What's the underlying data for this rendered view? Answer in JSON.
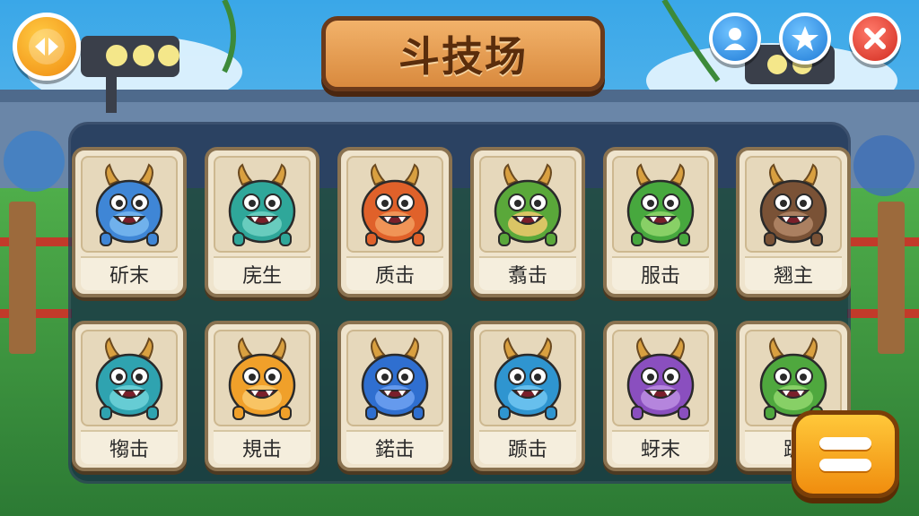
{
  "header": {
    "title": "斗技场"
  },
  "buttons": {
    "back_icon": "play-pause-icon",
    "user_icon": "user-icon",
    "star_icon": "star-icon",
    "close_icon": "close-icon",
    "menu_icon": "menu-icon"
  },
  "roster": [
    {
      "name": "斫末",
      "body": "#3f86d6",
      "belly": "#76b6ee"
    },
    {
      "name": "庑生",
      "body": "#2fa79a",
      "belly": "#6fd0c2"
    },
    {
      "name": "质击",
      "body": "#e0612a",
      "belly": "#f29a5c"
    },
    {
      "name": "翥击",
      "body": "#5aa83a",
      "belly": "#e8c86a"
    },
    {
      "name": "服击",
      "body": "#47a83e",
      "belly": "#8fd46a"
    },
    {
      "name": "翘主",
      "body": "#7a5236",
      "belly": "#b08566"
    },
    {
      "name": "犓击",
      "body": "#2fa3b0",
      "belly": "#6dd0d8"
    },
    {
      "name": "規击",
      "body": "#f0a02a",
      "belly": "#f8c86a"
    },
    {
      "name": "鍩击",
      "body": "#2f6fd0",
      "belly": "#6b9ef0"
    },
    {
      "name": "踬击",
      "body": "#2f95d0",
      "belly": "#6ec3ef"
    },
    {
      "name": "蚜末",
      "body": "#8a4fbf",
      "belly": "#b98be0"
    },
    {
      "name": "踬",
      "body": "#4fa83e",
      "belly": "#8dd46a"
    }
  ]
}
